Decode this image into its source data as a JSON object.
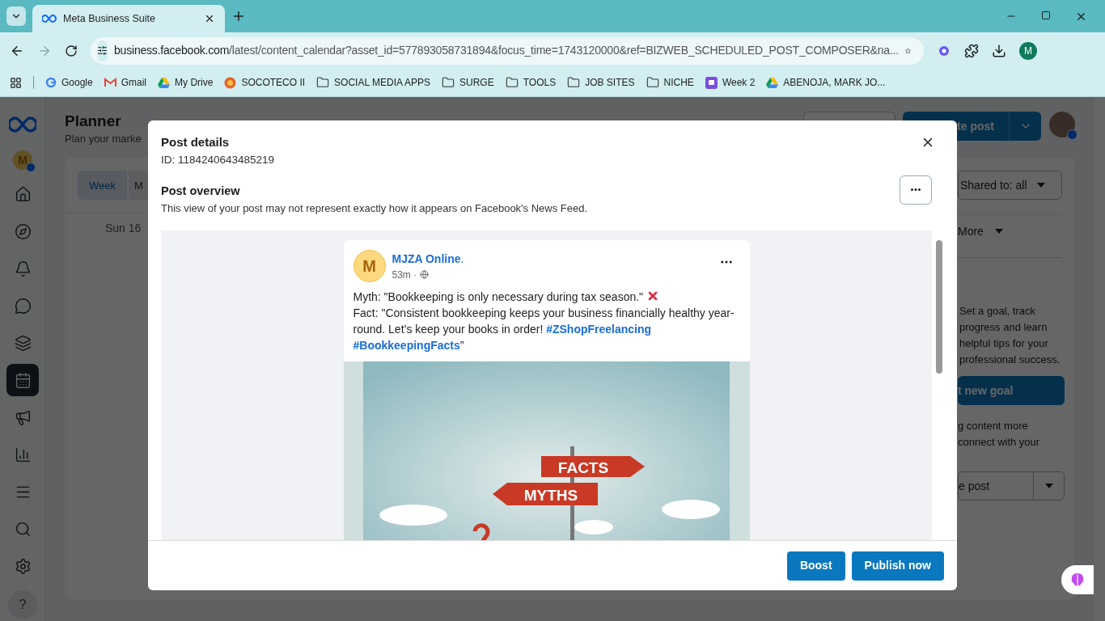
{
  "browser": {
    "tabs": [
      {
        "title": "Meta Business Suite",
        "selected": true
      }
    ],
    "url_host": "business.facebook.com",
    "url_path": "/latest/content_calendar?asset_id=577893058731894&focus_time=1743120000&ref=BIZWEB_SCHEDULED_POST_COMPOSER&na...",
    "profile_initial": "M",
    "bookmarks": [
      {
        "kind": "google",
        "label": "Google"
      },
      {
        "kind": "gmail",
        "label": "Gmail"
      },
      {
        "kind": "drive",
        "label": "My Drive"
      },
      {
        "kind": "site",
        "label": "SOCOTECO II"
      },
      {
        "kind": "folder",
        "label": "SOCIAL MEDIA APPS"
      },
      {
        "kind": "folder",
        "label": "SURGE"
      },
      {
        "kind": "folder",
        "label": "TOOLS"
      },
      {
        "kind": "folder",
        "label": "JOB SITES"
      },
      {
        "kind": "folder",
        "label": "NICHE"
      },
      {
        "kind": "app",
        "label": "Week 2"
      },
      {
        "kind": "drive",
        "label": "ABENOJA, MARK JO..."
      }
    ]
  },
  "sidebar": {
    "account_initial": "M",
    "items": [
      {
        "kind": "home",
        "selected": false
      },
      {
        "kind": "compass",
        "selected": false
      },
      {
        "kind": "bell",
        "selected": false
      },
      {
        "kind": "chat",
        "selected": false
      },
      {
        "kind": "layers",
        "selected": false
      },
      {
        "kind": "calendar",
        "selected": true
      },
      {
        "kind": "megaphone",
        "selected": false
      },
      {
        "kind": "chart",
        "selected": false
      },
      {
        "kind": "menu",
        "selected": false
      },
      {
        "kind": "search",
        "selected": false
      },
      {
        "kind": "settings",
        "selected": false
      }
    ],
    "help_label": "?"
  },
  "planner": {
    "title": "Planner",
    "subtitle": "Plan your marke",
    "create_button": "te post",
    "view_tabs": [
      {
        "label": "Week",
        "selected": true
      },
      {
        "label": "M",
        "selected": false
      }
    ],
    "day": "Sun 16",
    "shared_filter": "Shared to: all",
    "more": "More",
    "goal_text": "Set a goal, track progress and learn helpful tips for your professional success.",
    "goal_button": "t new goal",
    "content_text": [
      "g content more",
      "connect with your"
    ],
    "post_button": "e post"
  },
  "modal": {
    "title": "Post details",
    "id": "ID: 1184240643485219",
    "overview_title": "Post overview",
    "overview_note": "This view of your post may not represent exactly how it appears on Facebook's News Feed.",
    "post": {
      "avatar_initial": "M",
      "page_name": "MJZA Online",
      "page_name_suffix": ".",
      "time": "53m",
      "time_separator": "·",
      "body": [
        {
          "kind": "text",
          "text": "Myth: \"Bookkeeping is only necessary during tax season.\""
        },
        {
          "kind": "cross"
        },
        {
          "kind": "break"
        },
        {
          "kind": "text",
          "text": "Fact: \"Consistent bookkeeping keeps your business financially healthy year-round. Let’s keep your books in order!"
        },
        {
          "kind": "hashtag",
          "text": "#ZShopFreelancing"
        },
        {
          "kind": "hashtag",
          "text": "#BookkeepingFacts",
          "after": "”"
        }
      ],
      "image_signs": [
        "FACTS",
        "MYTHS"
      ]
    },
    "buttons": [
      {
        "label": "Boost"
      },
      {
        "label": "Publish now"
      }
    ]
  }
}
